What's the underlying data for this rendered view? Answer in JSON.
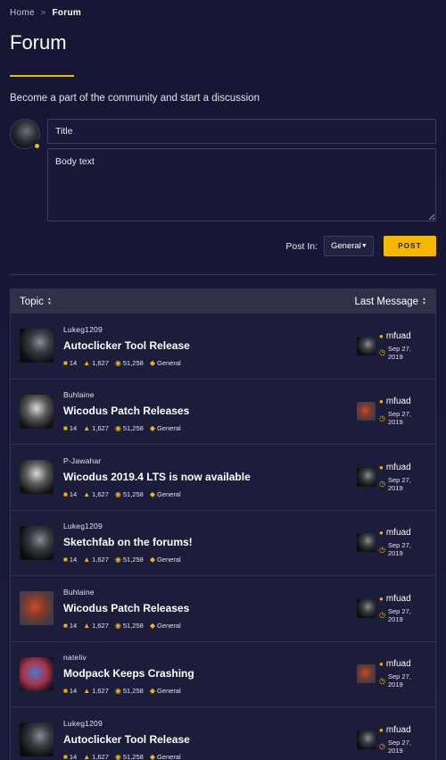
{
  "breadcrumb": {
    "home": "Home",
    "separator": ">",
    "current": "Forum"
  },
  "page": {
    "title": "Forum",
    "subtitle": "Become a part of the community and start a discussion"
  },
  "composer": {
    "title_placeholder": "Title",
    "body_placeholder": "Body text",
    "post_in_label": "Post In:",
    "category_selected": "General",
    "post_label": "POST"
  },
  "table": {
    "topic_header": "Topic",
    "last_message_header": "Last Message"
  },
  "topics": [
    {
      "author": "Lukeg1209",
      "title": "Autoclicker Tool Release",
      "comments": "14",
      "likes": "1,627",
      "views": "51,258",
      "category": "General",
      "last_user": "mfuad",
      "last_date": "Sep 27, 2019"
    },
    {
      "author": "Buhlaine",
      "title": "Wicodus Patch Releases",
      "comments": "14",
      "likes": "1,627",
      "views": "51,258",
      "category": "General",
      "last_user": "mfuad",
      "last_date": "Sep 27, 2019"
    },
    {
      "author": "P-Jawahar",
      "title": "Wicodus 2019.4 LTS is now available",
      "comments": "14",
      "likes": "1,627",
      "views": "51,258",
      "category": "General",
      "last_user": "mfuad",
      "last_date": "Sep 27, 2019"
    },
    {
      "author": "Lukeg1209",
      "title": "Sketchfab on the forums!",
      "comments": "14",
      "likes": "1,627",
      "views": "51,258",
      "category": "General",
      "last_user": "mfuad",
      "last_date": "Sep 27, 2019"
    },
    {
      "author": "Buhlaine",
      "title": "Wicodus Patch Releases",
      "comments": "14",
      "likes": "1,627",
      "views": "51,258",
      "category": "General",
      "last_user": "mfuad",
      "last_date": "Sep 27, 2019"
    },
    {
      "author": "nateliv",
      "title": "Modpack Keeps Crashing",
      "comments": "14",
      "likes": "1,627",
      "views": "51,258",
      "category": "General",
      "last_user": "mfuad",
      "last_date": "Sep 27, 2019"
    },
    {
      "author": "Lukeg1209",
      "title": "Autoclicker Tool Release",
      "comments": "14",
      "likes": "1,627",
      "views": "51,258",
      "category": "General",
      "last_user": "mfuad",
      "last_date": "Sep 27, 2019"
    }
  ],
  "colors": {
    "accent": "#f5b800",
    "background": "#151634",
    "row": "#1b1d3b",
    "header": "#2f3149"
  }
}
